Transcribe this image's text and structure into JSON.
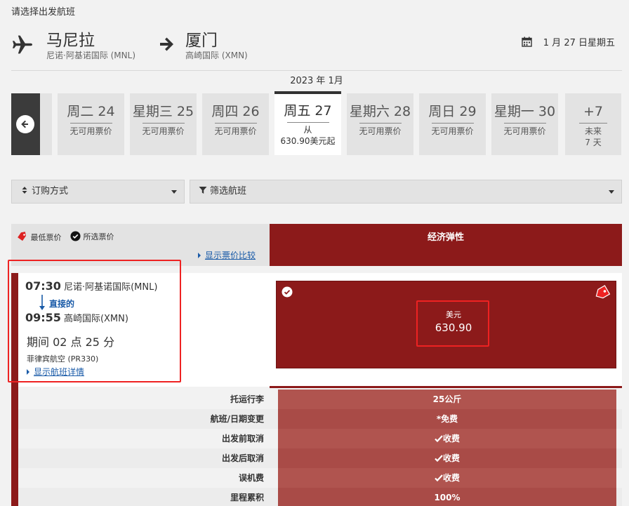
{
  "page": {
    "heading": "请选择出发航班"
  },
  "route": {
    "origin_city": "马尼拉",
    "origin_airport": "尼诺·阿基诺国际 (MNL)",
    "dest_city": "厦门",
    "dest_airport": "高崎国际 (XMN)",
    "date": "1 月 27 日星期五"
  },
  "calendar": {
    "month": "2023 年 1月",
    "days": [
      {
        "label": "周二 24",
        "note": "无可用票价"
      },
      {
        "label": "星期三 25",
        "note": "无可用票价"
      },
      {
        "label": "周四 26",
        "note": "无可用票价"
      },
      {
        "label": "周五 27",
        "note1": "从",
        "note2": "630.90美元起"
      },
      {
        "label": "星期六 28",
        "note": "无可用票价"
      },
      {
        "label": "周日 29",
        "note": "无可用票价"
      },
      {
        "label": "星期一 30",
        "note": "无可用票价"
      },
      {
        "label": "+7",
        "note1": "未来",
        "note2": "7 天"
      }
    ]
  },
  "controls": {
    "sort_label": "订购方式",
    "filter_label": "筛选航班"
  },
  "legend": {
    "lowest": "最低票价",
    "selected": "所选票价",
    "compare_link": "显示票价比较"
  },
  "cabin": {
    "name": "经济弹性"
  },
  "flight": {
    "depart_time": "07:30",
    "depart_airport": "尼诺·阿基诺国际(MNL)",
    "stop_type": "直接的",
    "arrive_time": "09:55",
    "arrive_airport": "高崎国际(XMN)",
    "duration": "期间 02 点 25 分",
    "carrier": "菲律宾航空 (PR330)",
    "details_link": "显示航班详情"
  },
  "fare": {
    "currency": "美元",
    "amount": "630.90"
  },
  "conditions": [
    {
      "label": "托运行李",
      "value": "25公斤"
    },
    {
      "label": "航班/日期变更",
      "value": "*免费"
    },
    {
      "label": "出发前取消",
      "value": "收费"
    },
    {
      "label": "出发后取消",
      "value": "收费"
    },
    {
      "label": "误机费",
      "value": "收费"
    },
    {
      "label": "里程累积",
      "value": "100%"
    }
  ],
  "colors": {
    "brand": "#8c1a1a",
    "link": "#1a5ba8",
    "highlight": "#e22222"
  }
}
